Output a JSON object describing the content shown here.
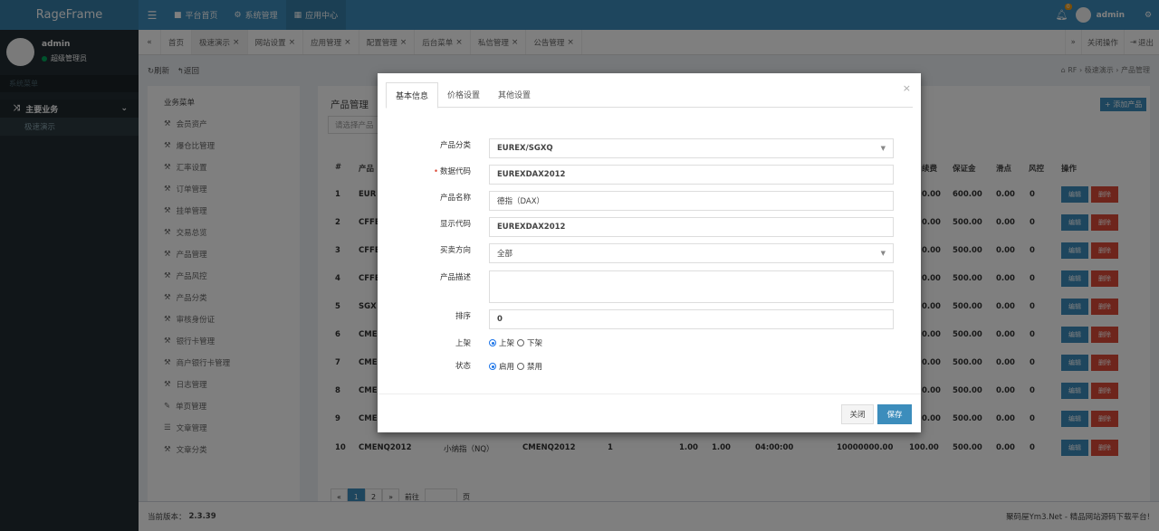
{
  "app": {
    "logo": "RageFrame"
  },
  "header": {
    "nav": [
      {
        "icon": "bookmark-icon",
        "label": "平台首页"
      },
      {
        "icon": "cogs-icon",
        "label": "系统管理"
      },
      {
        "icon": "grid-icon",
        "label": "应用中心"
      }
    ],
    "notifications": "0",
    "user": "admin"
  },
  "sidebar": {
    "user_name": "admin",
    "role": "超级管理员",
    "section_header": "系统菜单",
    "group": "主要业务",
    "sub_item": "极速演示"
  },
  "tabs": {
    "items": [
      "首页",
      "极速演示",
      "网站设置",
      "应用管理",
      "配置管理",
      "后台菜单",
      "私信管理",
      "公告管理"
    ],
    "close_ops": "关闭操作",
    "logout": "退出"
  },
  "breadcrumb": {
    "refresh": "刷新",
    "back": "返回",
    "path": [
      "RF",
      "极速演示",
      "产品管理"
    ]
  },
  "business_menu": {
    "title": "业务菜单",
    "items": [
      "会员资产",
      "爆仓比管理",
      "汇率设置",
      "订单管理",
      "挂单管理",
      "交易总览",
      "产品管理",
      "产品风控",
      "产品分类",
      "审核身份证",
      "银行卡管理",
      "商户银行卡管理",
      "日志管理",
      "单页管理",
      "文章管理",
      "文章分类"
    ]
  },
  "product_list": {
    "title": "产品管理",
    "add_button": "+ 添加产品",
    "search_placeholder": "请选择产品",
    "columns_left": [
      "#",
      "产品"
    ],
    "columns_right": [
      "续费",
      "保证金",
      "滑点",
      "风控",
      "操作"
    ],
    "rows": [
      {
        "n": "1",
        "code": "EUR",
        "fee": "0.00",
        "margin": "600.00",
        "slip": "0.00",
        "risk": "0"
      },
      {
        "n": "2",
        "code": "CFFE",
        "fee": "0.00",
        "margin": "500.00",
        "slip": "0.00",
        "risk": "0"
      },
      {
        "n": "3",
        "code": "CFFE",
        "fee": "0.00",
        "margin": "500.00",
        "slip": "0.00",
        "risk": "0"
      },
      {
        "n": "4",
        "code": "CFFE",
        "fee": "0.00",
        "margin": "500.00",
        "slip": "0.00",
        "risk": "0"
      },
      {
        "n": "5",
        "code": "SGX",
        "fee": "0.00",
        "margin": "500.00",
        "slip": "0.00",
        "risk": "0"
      },
      {
        "n": "6",
        "code": "CME",
        "fee": "0.00",
        "margin": "500.00",
        "slip": "0.00",
        "risk": "0"
      },
      {
        "n": "7",
        "code": "CME",
        "fee": "0.00",
        "margin": "500.00",
        "slip": "0.00",
        "risk": "0"
      },
      {
        "n": "8",
        "code": "CME",
        "fee": "0.00",
        "margin": "500.00",
        "slip": "0.00",
        "risk": "0"
      },
      {
        "n": "9",
        "code": "CME",
        "fee": "0.00",
        "margin": "500.00",
        "slip": "0.00",
        "risk": "0"
      }
    ],
    "last_row": {
      "n": "10",
      "code": "CMENQ2012",
      "name": "小纳指（NQ）",
      "show": "CMENQ2012",
      "a": "1",
      "b": "1.00",
      "c": "1.00",
      "time": "04:00:00",
      "amount": "10000000.00",
      "fee": "100.00",
      "margin": "500.00",
      "slip": "0.00",
      "risk": "0"
    },
    "edit_label": "编辑",
    "delete_label": "删除",
    "pager": [
      "«",
      "1",
      "2",
      "»",
      "前往",
      "",
      "页"
    ]
  },
  "modal": {
    "tabs": [
      "基本信息",
      "价格设置",
      "其他设置"
    ],
    "close_x": "×",
    "fields": {
      "category_label": "产品分类",
      "category_value": "EUREX/SGXQ",
      "data_code_label": "数据代码",
      "data_code_value": "EUREXDAX2012",
      "name_label": "产品名称",
      "name_value": "德指（DAX）",
      "display_code_label": "显示代码",
      "display_code_value": "EUREXDAX2012",
      "direction_label": "买卖方向",
      "direction_value": "全部",
      "description_label": "产品描述",
      "sort_label": "排序",
      "sort_value": "0",
      "listed_label": "上架",
      "listed_on": "上架",
      "listed_off": "下架",
      "status_label": "状态",
      "status_on": "启用",
      "status_off": "禁用"
    },
    "close_button": "关闭",
    "save_button": "保存"
  },
  "footer": {
    "version_label": "当前版本：",
    "version": "2.3.39",
    "right_text": "聚码屋Ym3.Net - 精品网站源码下载平台!"
  },
  "colors": {
    "primary": "#3c8dbc",
    "danger": "#dd4b39",
    "sidebar": "#222d32"
  }
}
